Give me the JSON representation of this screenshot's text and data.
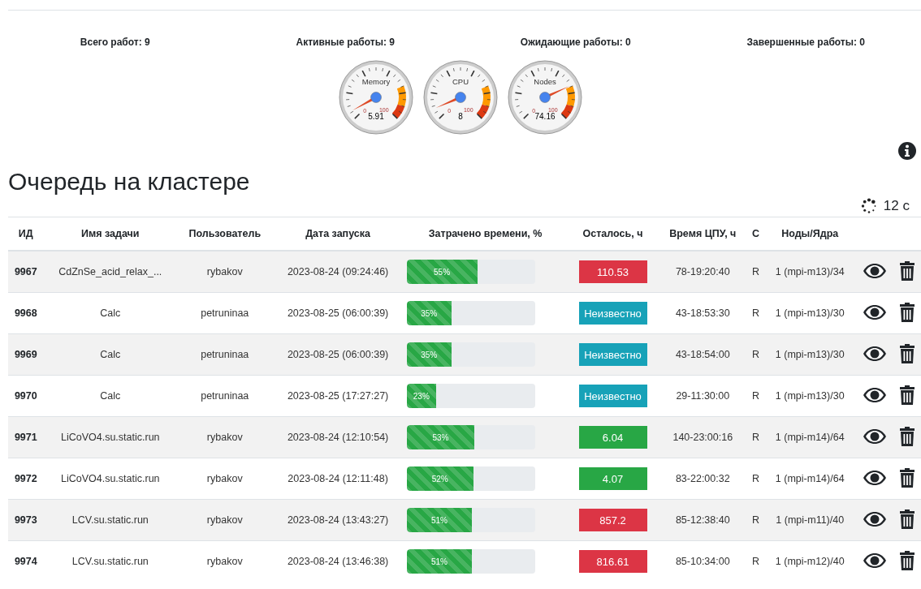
{
  "stats": [
    {
      "label": "Всего работ: 9"
    },
    {
      "label": "Активные работы: 9"
    },
    {
      "label": "Ожидающие работы: 0"
    },
    {
      "label": "Завершенные работы: 0"
    }
  ],
  "gauges": [
    {
      "title": "Memory",
      "value": "5.91",
      "min_label": "0",
      "max_label": "100"
    },
    {
      "title": "CPU",
      "value": "8",
      "min_label": "0",
      "max_label": "100"
    },
    {
      "title": "Nodes",
      "value": "74.16",
      "min_label": "0",
      "max_label": "100"
    }
  ],
  "heading": "Очередь на кластере",
  "refresh": {
    "text": "12 с"
  },
  "table": {
    "columns": [
      "ИД",
      "Имя задачи",
      "Пользователь",
      "Дата запуска",
      "Затрачено времени, %",
      "Осталось, ч",
      "Время ЦПУ, ч",
      "С",
      "Ноды/Ядра"
    ],
    "rows": [
      {
        "id": "9967",
        "name": "CdZnSe_acid_relax_...",
        "user": "rybakov",
        "start": "2023-08-24 (09:24:46)",
        "progress": "55%",
        "level": 0.55,
        "remaining": "110.53",
        "kind": "danger",
        "cpu": "78-19:20:40",
        "state": "R",
        "nodes": "1 (mpi-m13)/34"
      },
      {
        "id": "9968",
        "name": "Calc",
        "user": "petruninaa",
        "start": "2023-08-25 (06:00:39)",
        "progress": "35%",
        "level": 0.35,
        "remaining": "Неизвестно",
        "kind": "info",
        "cpu": "43-18:53:30",
        "state": "R",
        "nodes": "1 (mpi-m13)/30"
      },
      {
        "id": "9969",
        "name": "Calc",
        "user": "petruninaa",
        "start": "2023-08-25 (06:00:39)",
        "progress": "35%",
        "level": 0.35,
        "remaining": "Неизвестно",
        "kind": "info",
        "cpu": "43-18:54:00",
        "state": "R",
        "nodes": "1 (mpi-m13)/30"
      },
      {
        "id": "9970",
        "name": "Calc",
        "user": "petruninaa",
        "start": "2023-08-25 (17:27:27)",
        "progress": "23%",
        "level": 0.23,
        "remaining": "Неизвестно",
        "kind": "info",
        "cpu": "29-11:30:00",
        "state": "R",
        "nodes": "1 (mpi-m13)/30"
      },
      {
        "id": "9971",
        "name": "LiCoVO4.su.static.run",
        "user": "rybakov",
        "start": "2023-08-24 (12:10:54)",
        "progress": "53%",
        "level": 0.53,
        "remaining": "6.04",
        "kind": "success",
        "cpu": "140-23:00:16",
        "state": "R",
        "nodes": "1 (mpi-m14)/64"
      },
      {
        "id": "9972",
        "name": "LiCoVO4.su.static.run",
        "user": "rybakov",
        "start": "2023-08-24 (12:11:48)",
        "progress": "52%",
        "level": 0.52,
        "remaining": "4.07",
        "kind": "success",
        "cpu": "83-22:00:32",
        "state": "R",
        "nodes": "1 (mpi-m14)/64"
      },
      {
        "id": "9973",
        "name": "LCV.su.static.run",
        "user": "rybakov",
        "start": "2023-08-24 (13:43:27)",
        "progress": "51%",
        "level": 0.51,
        "remaining": "857.2",
        "kind": "danger",
        "cpu": "85-12:38:40",
        "state": "R",
        "nodes": "1 (mpi-m11)/40"
      },
      {
        "id": "9974",
        "name": "LCV.su.static.run",
        "user": "rybakov",
        "start": "2023-08-24 (13:46:38)",
        "progress": "51%",
        "level": 0.51,
        "remaining": "816.61",
        "kind": "danger",
        "cpu": "85-10:34:00",
        "state": "R",
        "nodes": "1 (mpi-m12)/40"
      }
    ]
  }
}
